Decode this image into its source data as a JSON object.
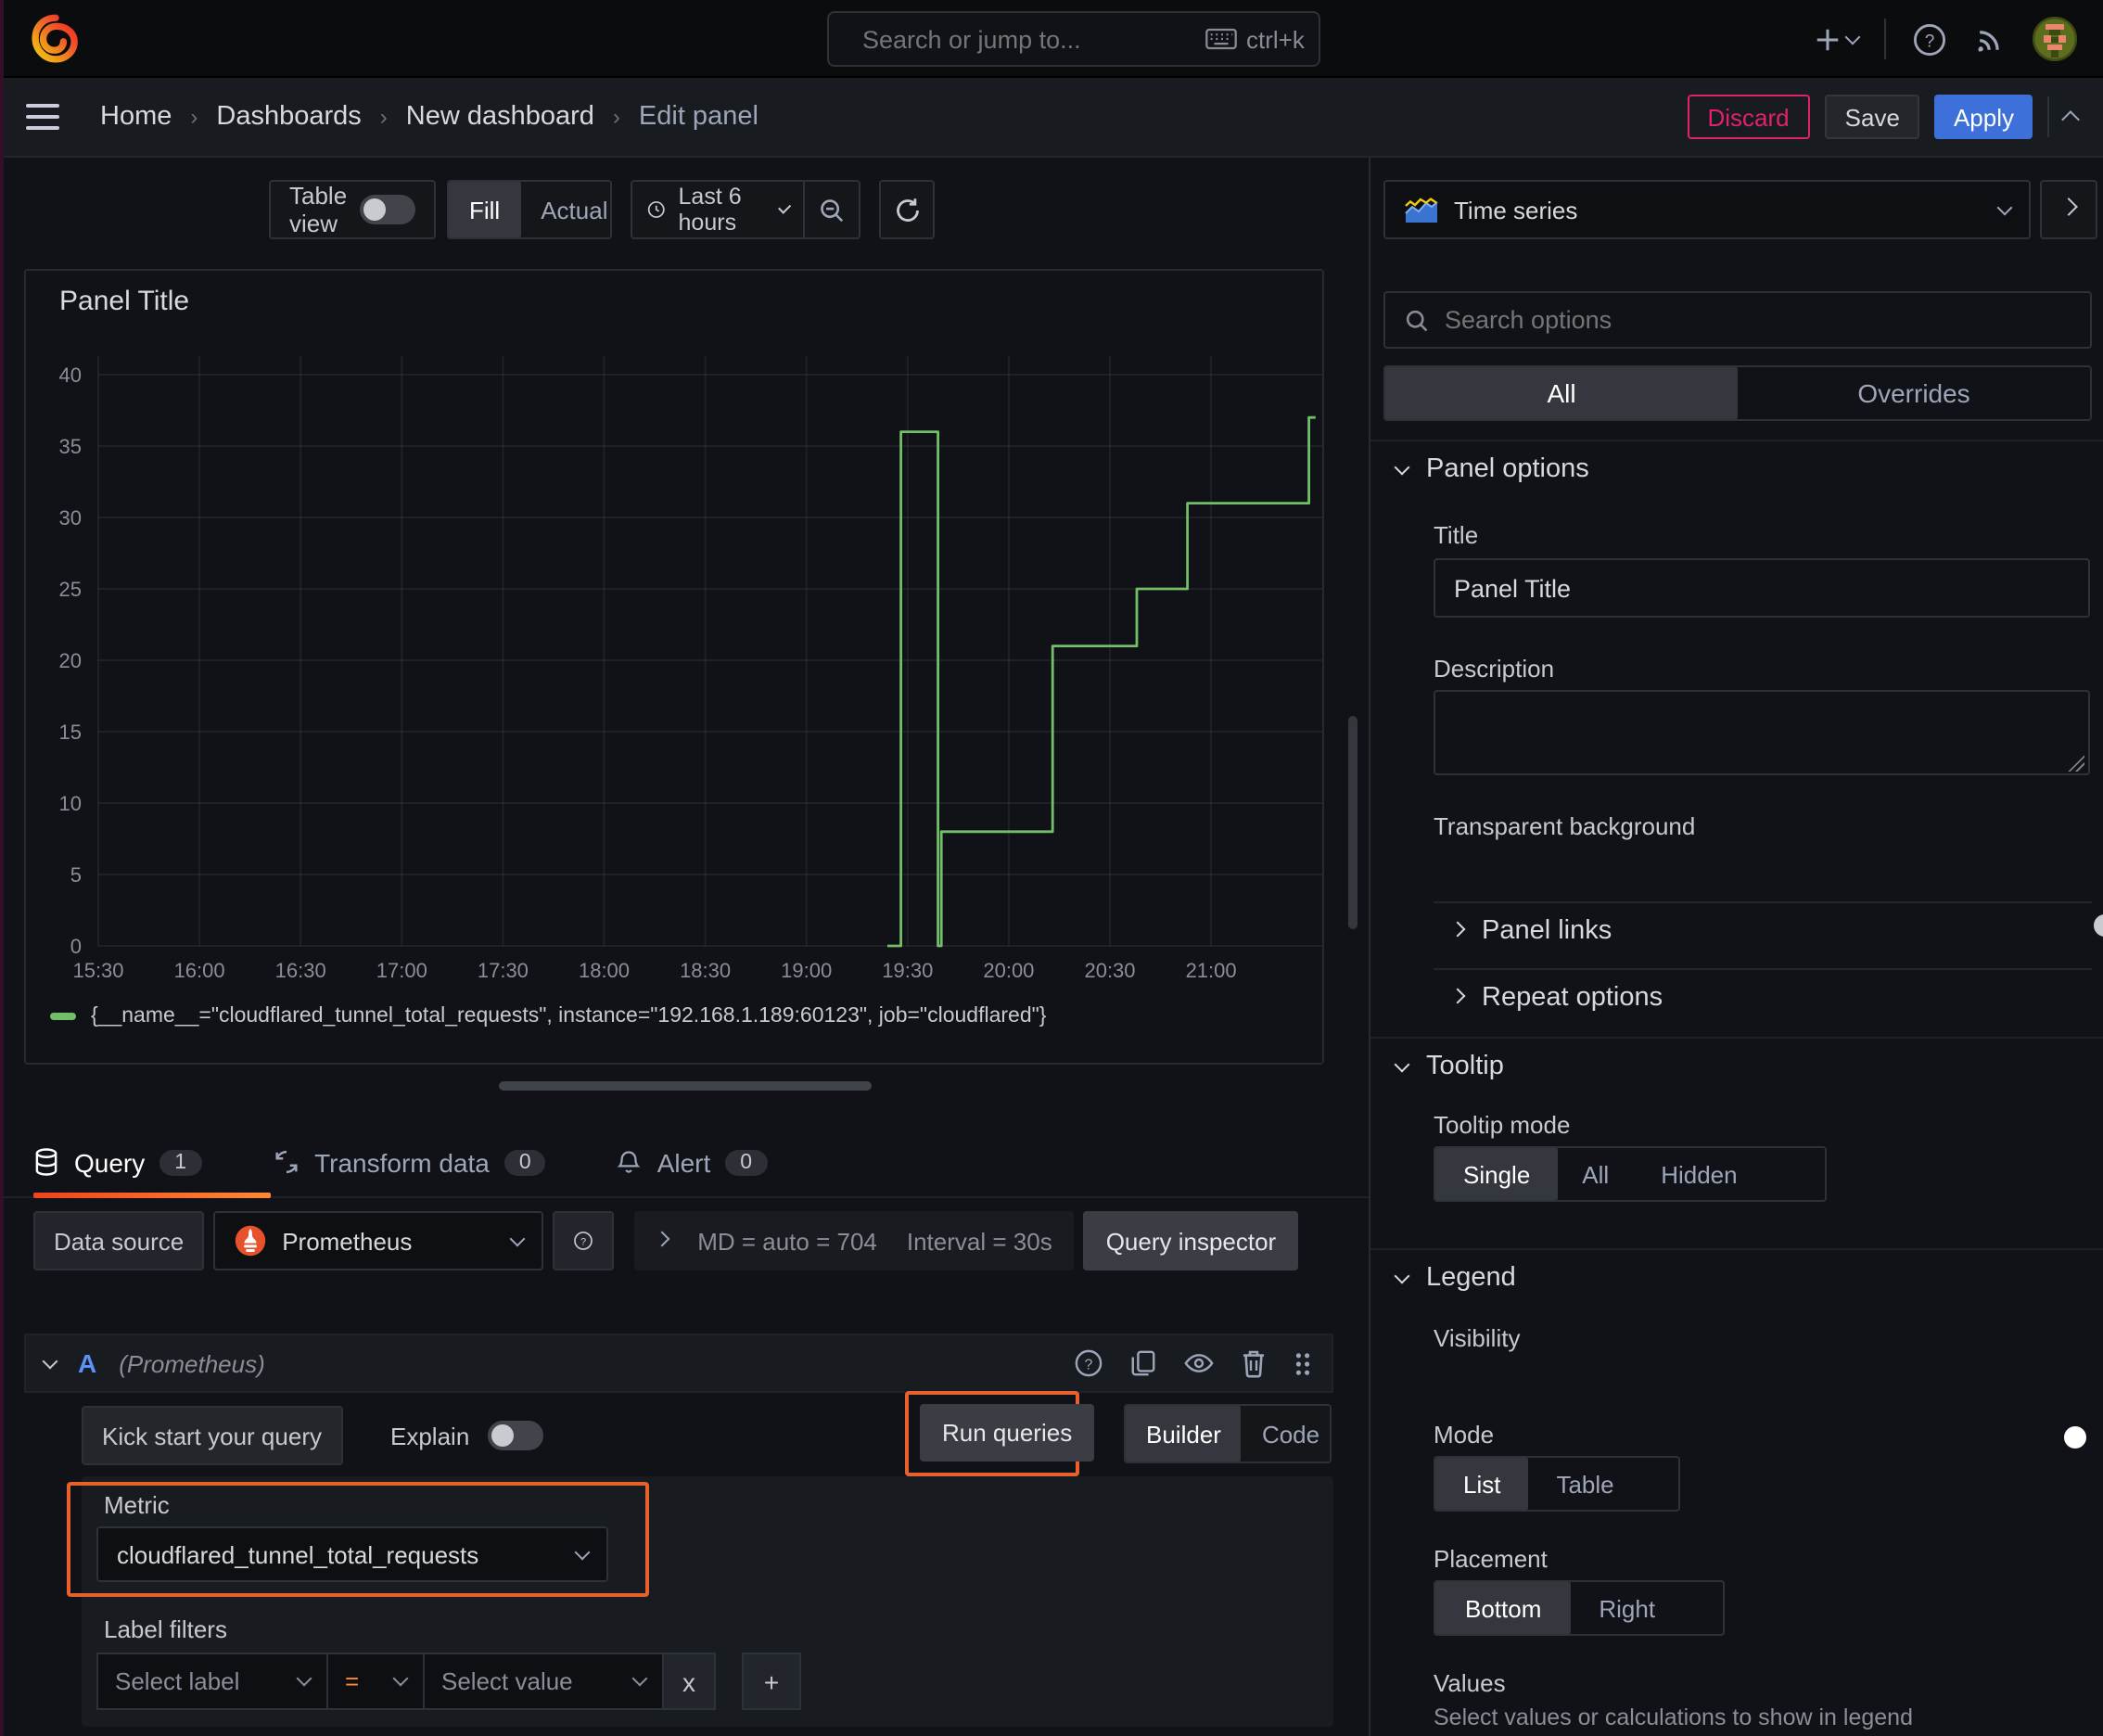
{
  "nav": {
    "search_placeholder": "Search or jump to...",
    "shortcut": "ctrl+k"
  },
  "breadcrumb": {
    "items": [
      "Home",
      "Dashboards",
      "New dashboard",
      "Edit panel"
    ],
    "discard_label": "Discard",
    "save_label": "Save",
    "apply_label": "Apply"
  },
  "toolbar": {
    "table_view_label": "Table view",
    "fill_label": "Fill",
    "actual_label": "Actual",
    "time_range_label": "Last 6 hours"
  },
  "panel": {
    "title": "Panel Title"
  },
  "chart_data": {
    "type": "line",
    "title": "Panel Title",
    "step": true,
    "grid": true,
    "legend_position": "bottom",
    "xlabel": "",
    "ylabel": "",
    "x_ticks": [
      "15:30",
      "16:00",
      "16:30",
      "17:00",
      "17:30",
      "18:00",
      "18:30",
      "19:00",
      "19:30",
      "20:00",
      "20:30",
      "21:00"
    ],
    "y_ticks": [
      0,
      5,
      10,
      15,
      20,
      25,
      30,
      35,
      40
    ],
    "ylim": [
      0,
      41.5
    ],
    "line_color": "#73BF69",
    "series": [
      {
        "name": "{__name__=\"cloudflared_tunnel_total_requests\", instance=\"192.168.1.189:60123\", job=\"cloudflared\"}",
        "color": "#73BF69",
        "points": [
          [
            "19:24",
            0
          ],
          [
            "19:28",
            0
          ],
          [
            "19:28",
            36
          ],
          [
            "19:39",
            36
          ],
          [
            "19:39",
            0
          ],
          [
            "19:40",
            0
          ],
          [
            "19:40",
            8
          ],
          [
            "20:13",
            8
          ],
          [
            "20:13",
            21
          ],
          [
            "20:38",
            21
          ],
          [
            "20:38",
            25
          ],
          [
            "20:53",
            25
          ],
          [
            "20:53",
            31
          ],
          [
            "21:29",
            31
          ],
          [
            "21:29",
            37
          ],
          [
            "21:31",
            37
          ]
        ]
      }
    ]
  },
  "tabs": {
    "query_label": "Query",
    "query_count": "1",
    "transform_label": "Transform data",
    "transform_count": "0",
    "alert_label": "Alert",
    "alert_count": "0"
  },
  "datasource": {
    "label": "Data source",
    "name": "Prometheus",
    "stats_md": "MD = auto = 704",
    "stats_interval": "Interval = 30s",
    "inspector_label": "Query inspector"
  },
  "query_editor": {
    "ref_id": "A",
    "source_hint": "(Prometheus)",
    "kickstart_label": "Kick start your query",
    "explain_label": "Explain",
    "run_label": "Run queries",
    "builder_label": "Builder",
    "code_label": "Code",
    "metric_label": "Metric",
    "metric_value": "cloudflared_tunnel_total_requests",
    "label_filters_label": "Label filters",
    "select_label_placeholder": "Select label",
    "operator": "=",
    "select_value_placeholder": "Select value",
    "remove_label": "x",
    "add_label": "+"
  },
  "options_pane": {
    "visualization": "Time series",
    "search_placeholder": "Search options",
    "tab_all": "All",
    "tab_overrides": "Overrides",
    "panel_options": {
      "header": "Panel options",
      "title_label": "Title",
      "title_value": "Panel Title",
      "description_label": "Description",
      "transparent_label": "Transparent background",
      "panel_links": "Panel links",
      "repeat_options": "Repeat options"
    },
    "tooltip": {
      "header": "Tooltip",
      "mode_label": "Tooltip mode",
      "single": "Single",
      "all": "All",
      "hidden": "Hidden"
    },
    "legend": {
      "header": "Legend",
      "visibility_label": "Visibility",
      "mode_label": "Mode",
      "list": "List",
      "table": "Table",
      "placement_label": "Placement",
      "bottom": "Bottom",
      "right": "Right",
      "values_label": "Values",
      "values_hint": "Select values or calculations to show in legend"
    }
  },
  "colors": {
    "accent_orange": "#e8602c",
    "brand_orange": "#F15B2A",
    "blue_primary": "#3D71D9",
    "series_green": "#73BF69",
    "discard_pink": "#E0226E",
    "tab_underline_from": "#f0431c",
    "tab_underline_to": "#ff8833"
  }
}
